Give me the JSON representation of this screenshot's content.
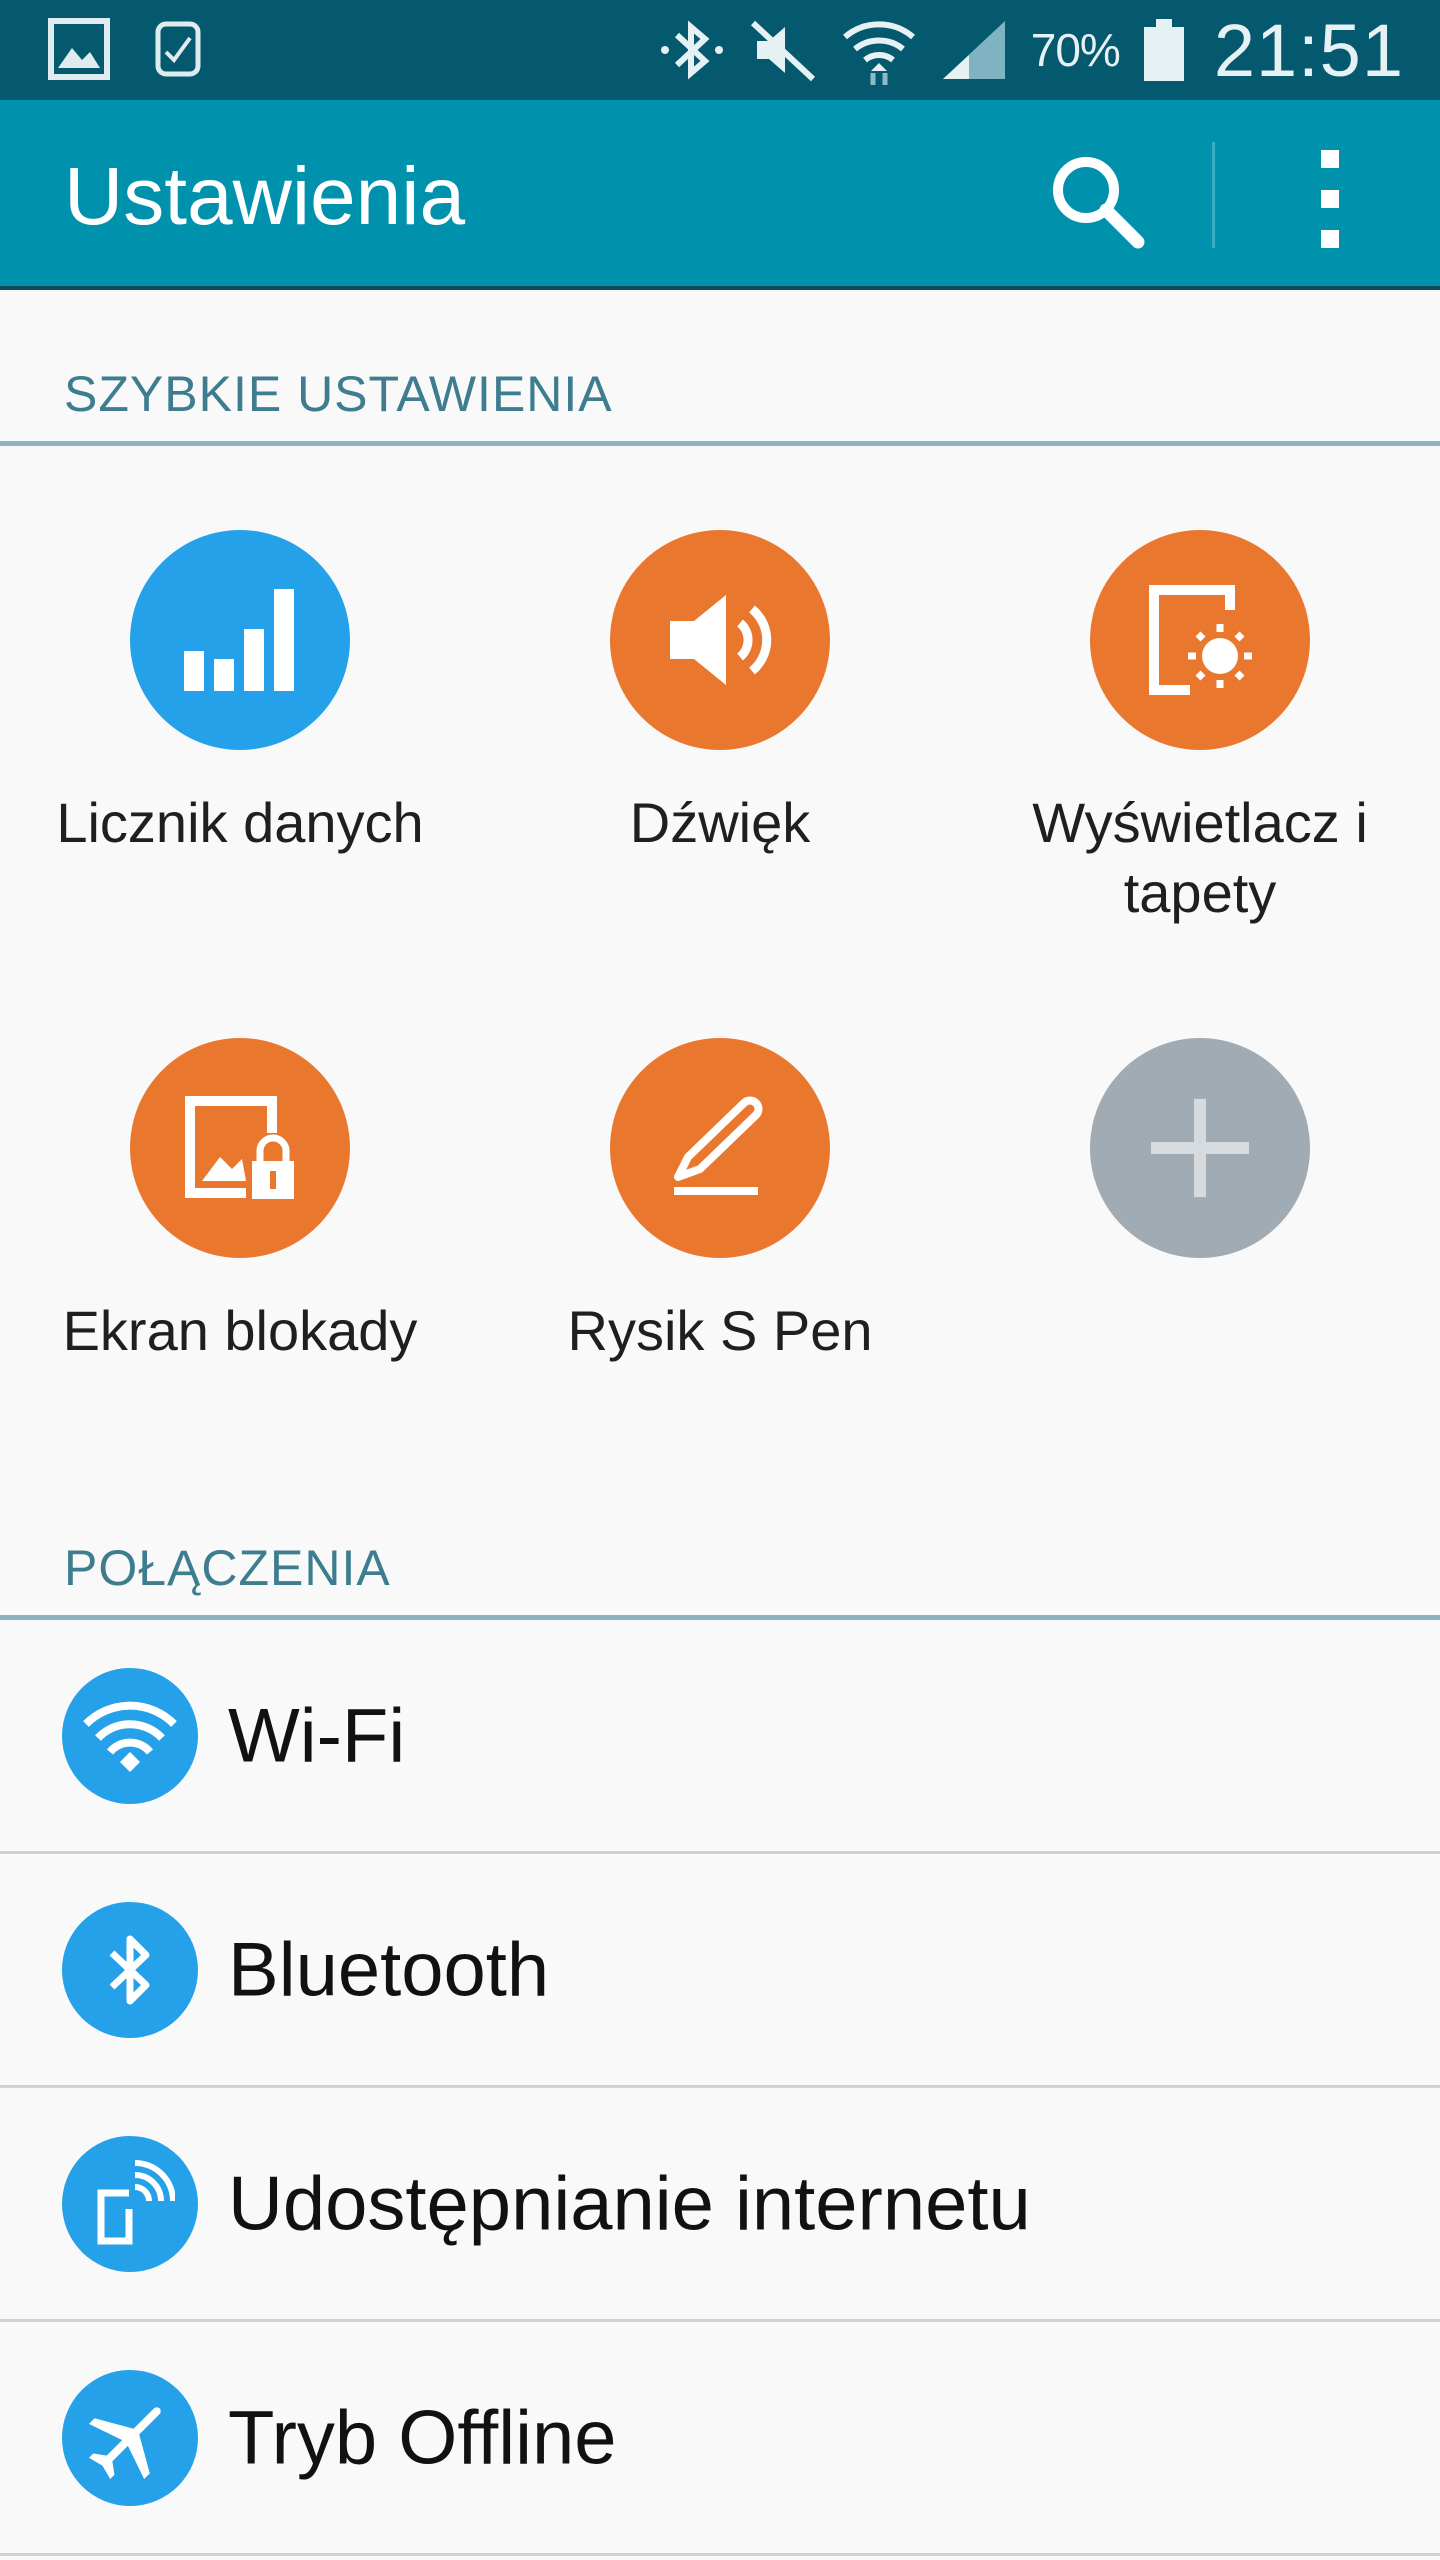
{
  "status_bar": {
    "battery_percent": "70%",
    "time": "21:51",
    "icons": [
      "gallery-icon",
      "watch-icon",
      "bluetooth-icon",
      "mute-icon",
      "wifi-icon",
      "signal-icon",
      "battery-icon"
    ]
  },
  "action_bar": {
    "title": "Ustawienia",
    "icons": [
      "search-icon",
      "more-options-icon"
    ]
  },
  "quick_settings": {
    "header": "SZYBKIE USTAWIENIA",
    "tiles": [
      {
        "label": "Licznik danych",
        "icon": "data-usage-icon",
        "color": "#25a1ea"
      },
      {
        "label": "Dźwięk",
        "icon": "sound-icon",
        "color": "#ea772e"
      },
      {
        "label": "Wyświetlacz i tapety",
        "icon": "display-icon",
        "color": "#ea772e"
      },
      {
        "label": "Ekran blokady",
        "icon": "lock-screen-icon",
        "color": "#ea772e"
      },
      {
        "label": "Rysik S Pen",
        "icon": "pen-icon",
        "color": "#ea772e"
      },
      {
        "label": "",
        "icon": "add-icon",
        "color": "#a0abb3"
      }
    ]
  },
  "connections": {
    "header": "POŁĄCZENIA",
    "items": [
      {
        "label": "Wi-Fi",
        "icon": "wifi-icon"
      },
      {
        "label": "Bluetooth",
        "icon": "bluetooth-icon"
      },
      {
        "label": "Udostępnianie internetu",
        "icon": "tethering-icon"
      },
      {
        "label": "Tryb Offline",
        "icon": "airplane-icon"
      }
    ]
  },
  "colors": {
    "status_bar": "#05596e",
    "action_bar": "#0092ad",
    "accent_blue": "#25a1ea",
    "accent_orange": "#ea772e",
    "disabled_gray": "#a0abb3",
    "section_text": "#3d7d8f"
  }
}
